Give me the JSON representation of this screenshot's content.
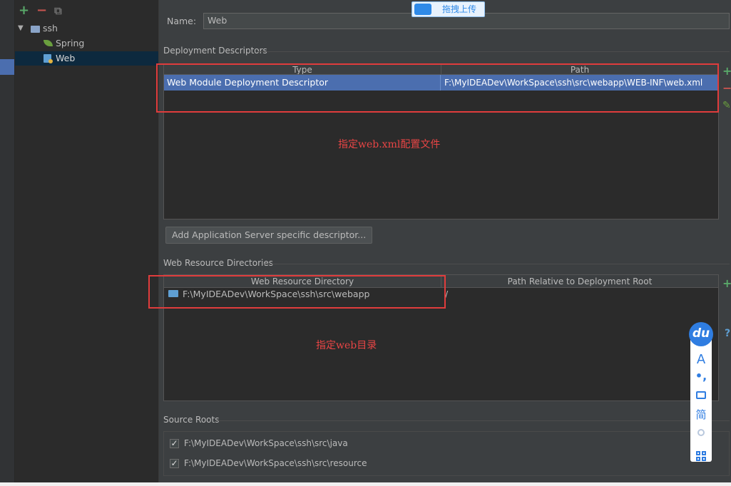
{
  "toolbar": {
    "add_label": "+",
    "remove_label": "−",
    "copy_label": "⧉"
  },
  "tree": {
    "root": {
      "label": "ssh",
      "expand_glyph": "▼"
    },
    "children": [
      {
        "label": "Spring"
      },
      {
        "label": "Web"
      }
    ]
  },
  "name_field": {
    "label": "Name:",
    "value": "Web"
  },
  "deployment": {
    "title": "Deployment Descriptors",
    "columns": [
      "Type",
      "Path"
    ],
    "rows": [
      {
        "type": "Web Module Deployment Descriptor",
        "path": "F:\\MyIDEADev\\WorkSpace\\ssh\\src\\webapp\\WEB-INF\\web.xml"
      }
    ],
    "annotation": "指定web.xml配置文件",
    "add_server_button": "Add Application Server specific descriptor..."
  },
  "web_resources": {
    "title": "Web Resource Directories",
    "columns": [
      "Web Resource Directory",
      "Path Relative to Deployment Root"
    ],
    "rows": [
      {
        "directory": "F:\\MyIDEADev\\WorkSpace\\ssh\\src\\webapp",
        "relative": "/"
      }
    ],
    "annotation": "指定web目录"
  },
  "source_roots": {
    "title": "Source Roots",
    "items": [
      {
        "path": "F:\\MyIDEADev\\WorkSpace\\ssh\\src\\java",
        "checked": true
      },
      {
        "path": "F:\\MyIDEADev\\WorkSpace\\ssh\\src\\resource",
        "checked": true
      }
    ]
  },
  "side_actions": {
    "add": "+",
    "remove": "−",
    "edit": "✎",
    "help": "?"
  },
  "upload_badge": {
    "label": "拖拽上传"
  },
  "baidu_toolbar": {
    "logo": "du",
    "items": [
      {
        "label": "A",
        "icon": "font-icon"
      },
      {
        "label": "•,",
        "icon": "punctuation-icon"
      },
      {
        "label": "",
        "icon": "toolbox-icon"
      },
      {
        "label": "简",
        "icon": "simplified-chinese-icon"
      },
      {
        "label": "",
        "icon": "user-icon"
      },
      {
        "label": "",
        "icon": "grid-icon"
      }
    ]
  },
  "colors": {
    "selection": "#4b6eaf",
    "annotation": "#e03c3c",
    "accent_green": "#59a869",
    "accent_red": "#c75450"
  }
}
